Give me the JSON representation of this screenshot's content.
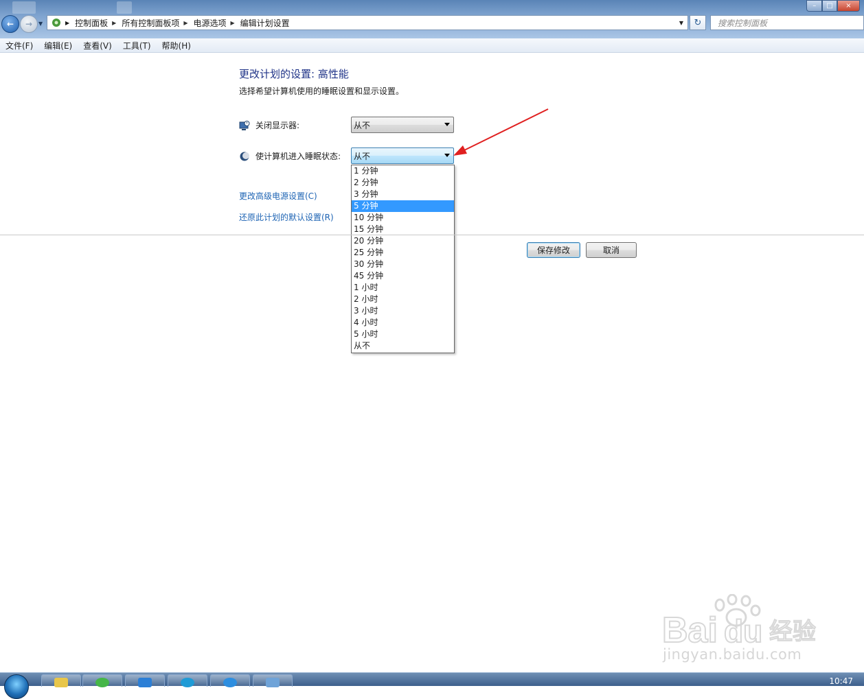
{
  "window": {
    "buttons": {
      "minimize": "–",
      "maximize": "□",
      "close": "×"
    }
  },
  "address": {
    "breadcrumbs": [
      "控制面板",
      "所有控制面板项",
      "电源选项",
      "编辑计划设置"
    ],
    "search_placeholder": "搜索控制面板"
  },
  "menu": [
    "文件(F)",
    "编辑(E)",
    "查看(V)",
    "工具(T)",
    "帮助(H)"
  ],
  "content": {
    "title": "更改计划的设置: 高性能",
    "description": "选择希望计算机使用的睡眠设置和显示设置。",
    "display_label": "关闭显示器:",
    "display_value": "从不",
    "sleep_label": "使计算机进入睡眠状态:",
    "sleep_value": "从不",
    "sleep_options": [
      "1 分钟",
      "2 分钟",
      "3 分钟",
      "5 分钟",
      "10 分钟",
      "15 分钟",
      "20 分钟",
      "25 分钟",
      "30 分钟",
      "45 分钟",
      "1 小时",
      "2 小时",
      "3 小时",
      "4 小时",
      "5 小时",
      "从不"
    ],
    "highlighted_option": "5 分钟",
    "advanced_link": "更改高级电源设置(C)",
    "restore_link": "还原此计划的默认设置(R)",
    "save_button": "保存修改",
    "cancel_button": "取消"
  },
  "watermark": {
    "text": "jingyan.baidu.com"
  },
  "taskbar": {
    "clock": "10:47"
  },
  "colors": {
    "accent": "#3399ff",
    "link": "#1e64b4",
    "title": "#1e3287",
    "annotation_arrow": "#e02020"
  }
}
